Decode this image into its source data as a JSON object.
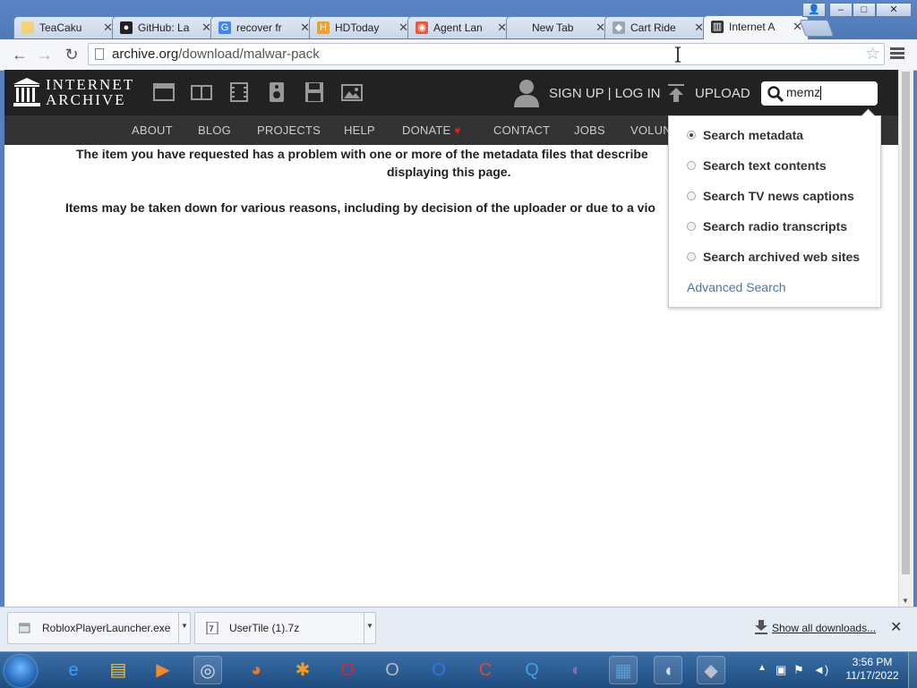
{
  "window": {
    "controls": [
      "–",
      "□",
      "✕"
    ],
    "user_icon": "user-icon"
  },
  "tabs": [
    {
      "title": "TeaCaku",
      "favicon": "folder-icon",
      "color": "#f3d27a",
      "glyph": ""
    },
    {
      "title": "GitHub: La",
      "favicon": "github-icon",
      "color": "#222222",
      "glyph": "●"
    },
    {
      "title": "recover fr",
      "favicon": "google-icon",
      "color": "#4285f4",
      "glyph": "G"
    },
    {
      "title": "HDToday",
      "favicon": "hdtoday-icon",
      "color": "#f0a030",
      "glyph": "H"
    },
    {
      "title": "Agent Lan",
      "favicon": "agent-icon",
      "color": "#e85a3c",
      "glyph": "◉"
    },
    {
      "title": "New Tab",
      "favicon": "",
      "color": "",
      "glyph": ""
    },
    {
      "title": "Cart Ride",
      "favicon": "roblox-icon",
      "color": "#9aa6b4",
      "glyph": "◆"
    },
    {
      "title": "Internet A",
      "favicon": "archive-icon",
      "color": "#333333",
      "glyph": "▥"
    }
  ],
  "toolbar": {
    "url_host": "archive.org",
    "url_path": "/download/malwar-pack",
    "back": "←",
    "forward": "→",
    "reload": "↻",
    "star": "☆"
  },
  "ia": {
    "logo_line1": "INTERNET",
    "logo_line2": "ARCHIVE",
    "signup_login": "SIGN UP | LOG IN",
    "upload": "UPLOAD",
    "search_value": "memz",
    "nav": [
      "ABOUT",
      "BLOG",
      "PROJECTS",
      "HELP",
      "DONATE",
      "CONTACT",
      "JOBS",
      "VOLUN"
    ],
    "donate_heart": "♥"
  },
  "message": {
    "line1": "The item you have requested has a problem with one or more of the metadata files that describe",
    "line2": "displaying this page.",
    "line3": "Items may be taken down for various reasons, including by decision of the uploader or due to a vio"
  },
  "search_dropdown": {
    "options": [
      {
        "label": "Search metadata",
        "selected": true
      },
      {
        "label": "Search text contents",
        "selected": false
      },
      {
        "label": "Search TV news captions",
        "selected": false
      },
      {
        "label": "Search radio transcripts",
        "selected": false
      },
      {
        "label": "Search archived web sites",
        "selected": false
      }
    ],
    "advanced": "Advanced Search"
  },
  "downloads": {
    "items": [
      {
        "name": "RobloxPlayerLauncher.exe",
        "icon": "exe-file-icon"
      },
      {
        "name": "UserTile (1).7z",
        "icon": "7z-archive-icon"
      }
    ],
    "show_all": "Show all downloads...",
    "close": "✕"
  },
  "taskbar": {
    "apps": [
      {
        "name": "ie-icon",
        "glyph": "e",
        "color": "#3aa0ff"
      },
      {
        "name": "explorer-icon",
        "glyph": "▤",
        "color": "#f2c04a"
      },
      {
        "name": "media-player-icon",
        "glyph": "▶",
        "color": "#f08a2a"
      },
      {
        "name": "chrome-icon",
        "glyph": "◎",
        "color": "#d9dde3"
      },
      {
        "name": "firefox-icon",
        "glyph": "◕",
        "color": "#f0762a"
      },
      {
        "name": "avast-icon",
        "glyph": "✱",
        "color": "#f39c1f"
      },
      {
        "name": "opera-icon",
        "glyph": "O",
        "color": "#e0242a"
      },
      {
        "name": "opera-gray-icon",
        "glyph": "O",
        "color": "#b5bac2"
      },
      {
        "name": "opera-blue-icon",
        "glyph": "O",
        "color": "#2a7ad8"
      },
      {
        "name": "ccleaner-icon",
        "glyph": "C",
        "color": "#e04a2a"
      },
      {
        "name": "search-app-icon",
        "glyph": "Q",
        "color": "#3fa0e0"
      },
      {
        "name": "tor-icon",
        "glyph": "◐",
        "color": "#8a64c8"
      },
      {
        "name": "control-panel-icon",
        "glyph": "▦",
        "color": "#5aa0d8"
      },
      {
        "name": "mouse-icon",
        "glyph": "◖",
        "color": "#d7dbe0"
      },
      {
        "name": "roblox-app-icon",
        "glyph": "◆",
        "color": "#b8c2cc"
      }
    ],
    "time": "3:56 PM",
    "date": "11/17/2022",
    "tray_up": "▲",
    "tray_icons": [
      "network-icon",
      "flag-icon",
      "volume-icon"
    ]
  }
}
